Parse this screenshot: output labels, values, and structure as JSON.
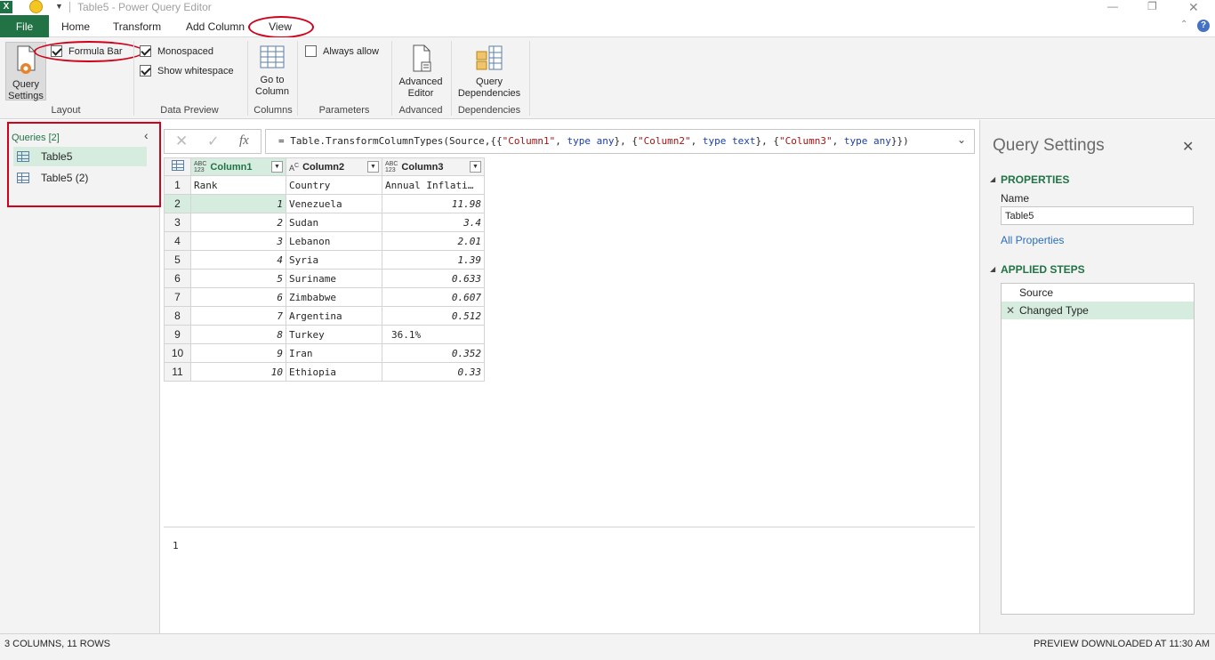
{
  "window": {
    "title": "Table5 - Power Query Editor"
  },
  "tabs": [
    "File",
    "Home",
    "Transform",
    "Add Column",
    "View"
  ],
  "ribbon": {
    "layout": {
      "query_settings_label_1": "Query",
      "query_settings_label_2": "Settings",
      "formula_bar_label": "Formula Bar",
      "group_label": "Layout"
    },
    "data_preview": {
      "monospaced_label": "Monospaced",
      "show_whitespace_label": "Show whitespace",
      "group_label": "Data Preview"
    },
    "columns": {
      "go_to_1": "Go to",
      "go_to_2": "Column",
      "group_label": "Columns"
    },
    "parameters": {
      "always_allow_label": "Always allow",
      "group_label": "Parameters"
    },
    "advanced": {
      "btn_1": "Advanced",
      "btn_2": "Editor",
      "group_label": "Advanced"
    },
    "dependencies": {
      "btn_1": "Query",
      "btn_2": "Dependencies",
      "group_label": "Dependencies"
    }
  },
  "queries": {
    "header": "Queries [2]",
    "items": [
      "Table5",
      "Table5 (2)"
    ]
  },
  "formula": {
    "fx": "fx",
    "p1": "= Table.TransformColumnTypes(Source,{{",
    "s1": "\"Column1\"",
    "p2": ", ",
    "k1": "type any",
    "p3": "}, {",
    "s2": "\"Column2\"",
    "p4": ", ",
    "k2": "type text",
    "p5": "}, {",
    "s3": "\"Column3\"",
    "p6": ", ",
    "k3": "type any",
    "p7": "}})"
  },
  "grid": {
    "columns": [
      {
        "name": "Column1",
        "type_top": "ABC",
        "type_bot": "123"
      },
      {
        "name": "Column2",
        "type_top": "A",
        "type_bot": "C"
      },
      {
        "name": "Column3",
        "type_top": "ABC",
        "type_bot": "123"
      }
    ],
    "rows": [
      [
        "1",
        "Rank",
        "Country",
        "Annual Inflati…"
      ],
      [
        "2",
        "1",
        "Venezuela",
        "11.98"
      ],
      [
        "3",
        "2",
        "Sudan",
        "3.4"
      ],
      [
        "4",
        "3",
        "Lebanon",
        "2.01"
      ],
      [
        "5",
        "4",
        "Syria",
        "1.39"
      ],
      [
        "6",
        "5",
        "Suriname",
        "0.633"
      ],
      [
        "7",
        "6",
        "Zimbabwe",
        "0.607"
      ],
      [
        "8",
        "7",
        "Argentina",
        "0.512"
      ],
      [
        "9",
        "8",
        "Turkey",
        "36.1%"
      ],
      [
        "10",
        "9",
        "Iran",
        "0.352"
      ],
      [
        "11",
        "10",
        "Ethiopia",
        "0.33"
      ]
    ]
  },
  "detail": {
    "value": "1"
  },
  "settings": {
    "title": "Query Settings",
    "properties_label": "PROPERTIES",
    "name_label": "Name",
    "name_value": "Table5",
    "all_properties": "All Properties",
    "applied_steps_label": "APPLIED STEPS",
    "steps": [
      "Source",
      "Changed Type"
    ]
  },
  "status": {
    "left": "3 COLUMNS, 11 ROWS",
    "right": "PREVIEW DOWNLOADED AT 11:30 AM"
  },
  "colors": {
    "accent_green": "#217346",
    "highlight_red": "#d0021b",
    "selection": "#d5ecdf"
  }
}
